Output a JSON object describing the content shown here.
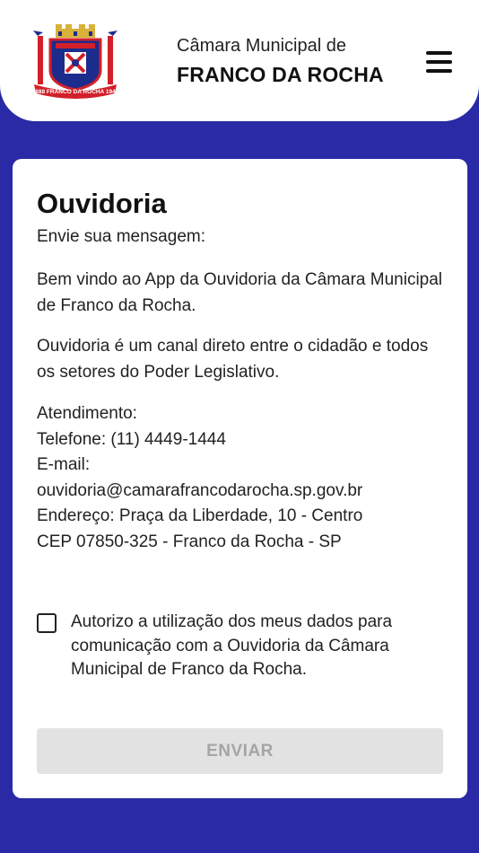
{
  "header": {
    "crest": {
      "banner_text": "1888 FRANCO DA ROCHA 1944",
      "colors": {
        "blue": "#1c2c8c",
        "red": "#d2202a",
        "gold": "#d9b13a"
      }
    },
    "org_line1": "Câmara Municipal de",
    "org_line2": "FRANCO DA ROCHA",
    "menu_icon": "hamburger-menu-icon"
  },
  "card": {
    "title": "Ouvidoria",
    "subtitle": "Envie sua mensagem:",
    "welcome": "Bem vindo ao App da Ouvidoria da Câmara Municipal de Franco da Rocha.",
    "description": "Ouvidoria é um canal direto entre o cidadão e todos os setores do Poder Legislativo.",
    "contact": {
      "heading": "Atendimento:",
      "phone": "Telefone: (11) 4449-1444",
      "email_label": "E-mail:",
      "email": "ouvidoria@camarafrancodarocha.sp.gov.br",
      "address": "Endereço: Praça da Liberdade, 10 - Centro",
      "cep": "CEP 07850-325 - Franco da Rocha - SP"
    },
    "consent": {
      "checked": false,
      "label": "Autorizo a utilização dos meus dados para comunicação com a Ouvidoria da Câmara Municipal de Franco da Rocha."
    },
    "submit_label": "ENVIAR"
  },
  "colors": {
    "background": "#2a2aa6",
    "disabled_button": "#e2e2e2",
    "disabled_text": "#a5a5a5"
  }
}
